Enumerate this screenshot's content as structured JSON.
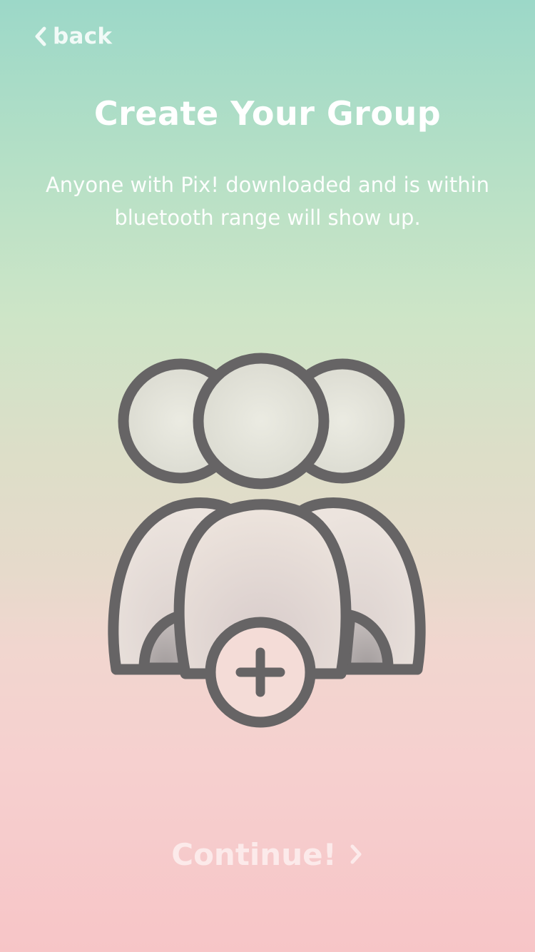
{
  "nav": {
    "back_label": "back",
    "back_icon": "chevron-left-icon"
  },
  "header": {
    "title": "Create Your Group",
    "subtitle": "Anyone with Pix! downloaded and is within bluetooth range will show up."
  },
  "illustration": {
    "icon": "add-group-icon",
    "badge_icon": "plus-icon"
  },
  "footer": {
    "continue_label": "Continue!",
    "continue_icon": "chevron-right-icon"
  },
  "colors": {
    "gradient_top": "#9cd8c8",
    "gradient_bottom": "#f7c5c7",
    "icon_stroke": "#666465",
    "text": "#ffffff"
  }
}
